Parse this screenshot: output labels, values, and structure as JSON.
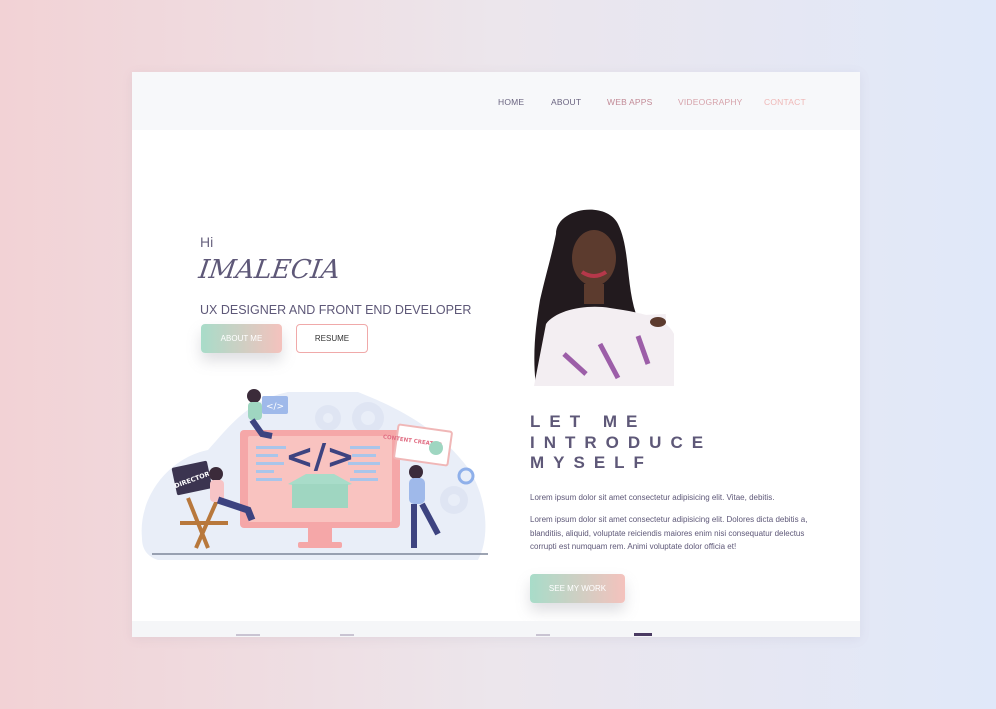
{
  "nav": {
    "items": [
      {
        "label": "HOME",
        "color": "#6a6480"
      },
      {
        "label": "ABOUT",
        "color": "#6a6480"
      },
      {
        "label": "WEB APPS",
        "color": "#c28a96"
      },
      {
        "label": "VIDEOGRAPHY",
        "color": "#d6a2aa"
      },
      {
        "label": "CONTACT",
        "color": "#efb7b6"
      }
    ]
  },
  "hero": {
    "greeting": "Hi",
    "name": "IMALECIA",
    "subtitle": "UX DESIGNER AND FRONT END DEVELOPER",
    "about_button": "ABOUT ME",
    "resume_button": "RESUME"
  },
  "illustration": {
    "chair_label": "DIRECTOR",
    "code_tag": "</>",
    "card_label": "CONTENT CREATOR"
  },
  "intro": {
    "heading_lines": [
      "LET ME",
      "INTRODUCE",
      "MYSELF"
    ],
    "paragraph_1": "Lorem ipsum dolor sit amet consectetur adipisicing elit. Vitae, debitis.",
    "paragraph_2": "Lorem ipsum dolor sit amet consectetur adipisicing elit. Dolores dicta debitis a, blanditiis, aliquid, voluptate reiciendis maiores enim nisi consequatur delectus corrupti est numquam rem. Animi voluptate dolor officia et!",
    "cta_button": "SEE MY WORK"
  },
  "colors": {
    "text_primary": "#5e5878",
    "accent_mint": "#a8dcc9",
    "accent_pink": "#f4c2bd",
    "nav_bg": "#f7f8fa"
  }
}
